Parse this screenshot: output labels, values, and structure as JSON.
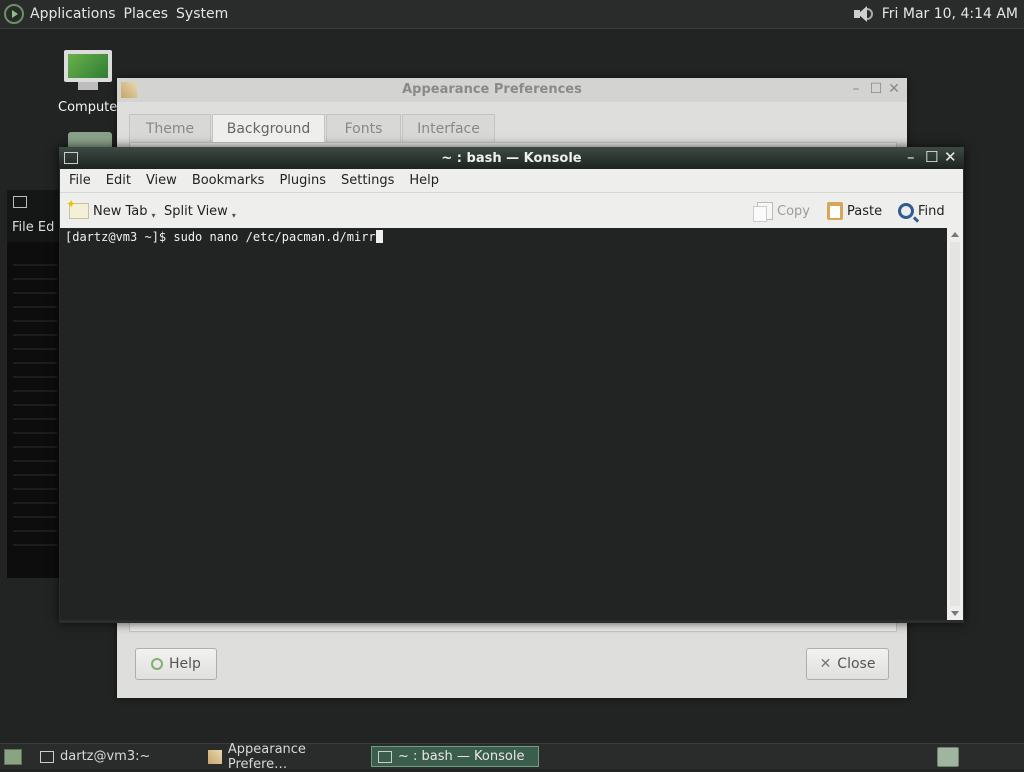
{
  "top_panel": {
    "menus": [
      "Applications",
      "Places",
      "System"
    ],
    "clock": "Fri Mar 10,  4:14 AM",
    "icons": {
      "logo": "menu-logo-icon",
      "volume": "speaker-icon"
    }
  },
  "desktop": {
    "computer_label": "Computer"
  },
  "bg_window": {
    "menu": "File  Ed"
  },
  "appearance": {
    "title": "Appearance Preferences",
    "tabs": [
      "Theme",
      "Background",
      "Fonts",
      "Interface"
    ],
    "active_tab": "Background",
    "help_label": "Help",
    "close_label": "Close"
  },
  "konsole": {
    "title": "~ : bash — Konsole",
    "menu": [
      "File",
      "Edit",
      "View",
      "Bookmarks",
      "Plugins",
      "Settings",
      "Help"
    ],
    "toolbar": {
      "new_tab": "New Tab",
      "split_view": "Split View",
      "copy": "Copy",
      "paste": "Paste",
      "find": "Find"
    },
    "prompt_line": "[dartz@vm3 ~]$ sudo nano /etc/pacman.d/mirr"
  },
  "taskbar": {
    "tasks": [
      "dartz@vm3:~",
      "Appearance Prefere…",
      "~ : bash — Konsole"
    ],
    "active_task": "~ : bash — Konsole"
  }
}
